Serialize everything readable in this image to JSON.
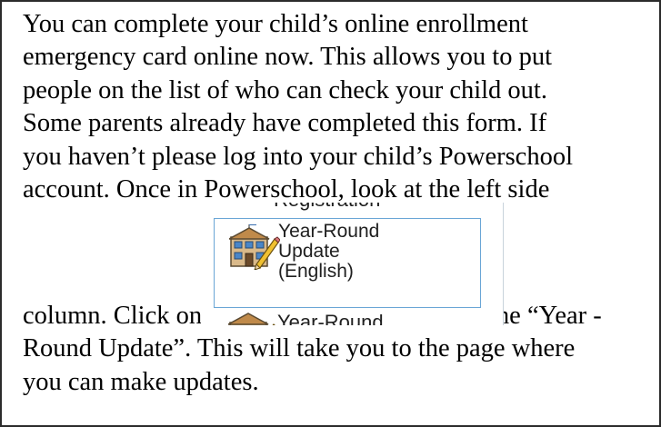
{
  "paragraph": {
    "line1": "You can complete your child’s online enrollment",
    "line2": "emergency card online now. This allows you to put",
    "line3": "people on the list of who can check your child out.",
    "line4": "Some parents already have completed this form. If",
    "line5": "you haven’t please log into your child’s Powerschool",
    "line6": "account. Once in Powerschool, look at the left side",
    "line7_start": "column. Click on",
    "line7_end": "the “Year -",
    "line8": "Round Update”. This will take you to the page where",
    "line9": "you can make updates."
  },
  "screenshot_snippet": {
    "top_label": "Registration",
    "item_label_line1": "Year-Round",
    "item_label_line2": "Update",
    "item_label_line3": "(English)",
    "bottom_label": "Year-Round",
    "icon": "school-building-pencil-icon"
  }
}
